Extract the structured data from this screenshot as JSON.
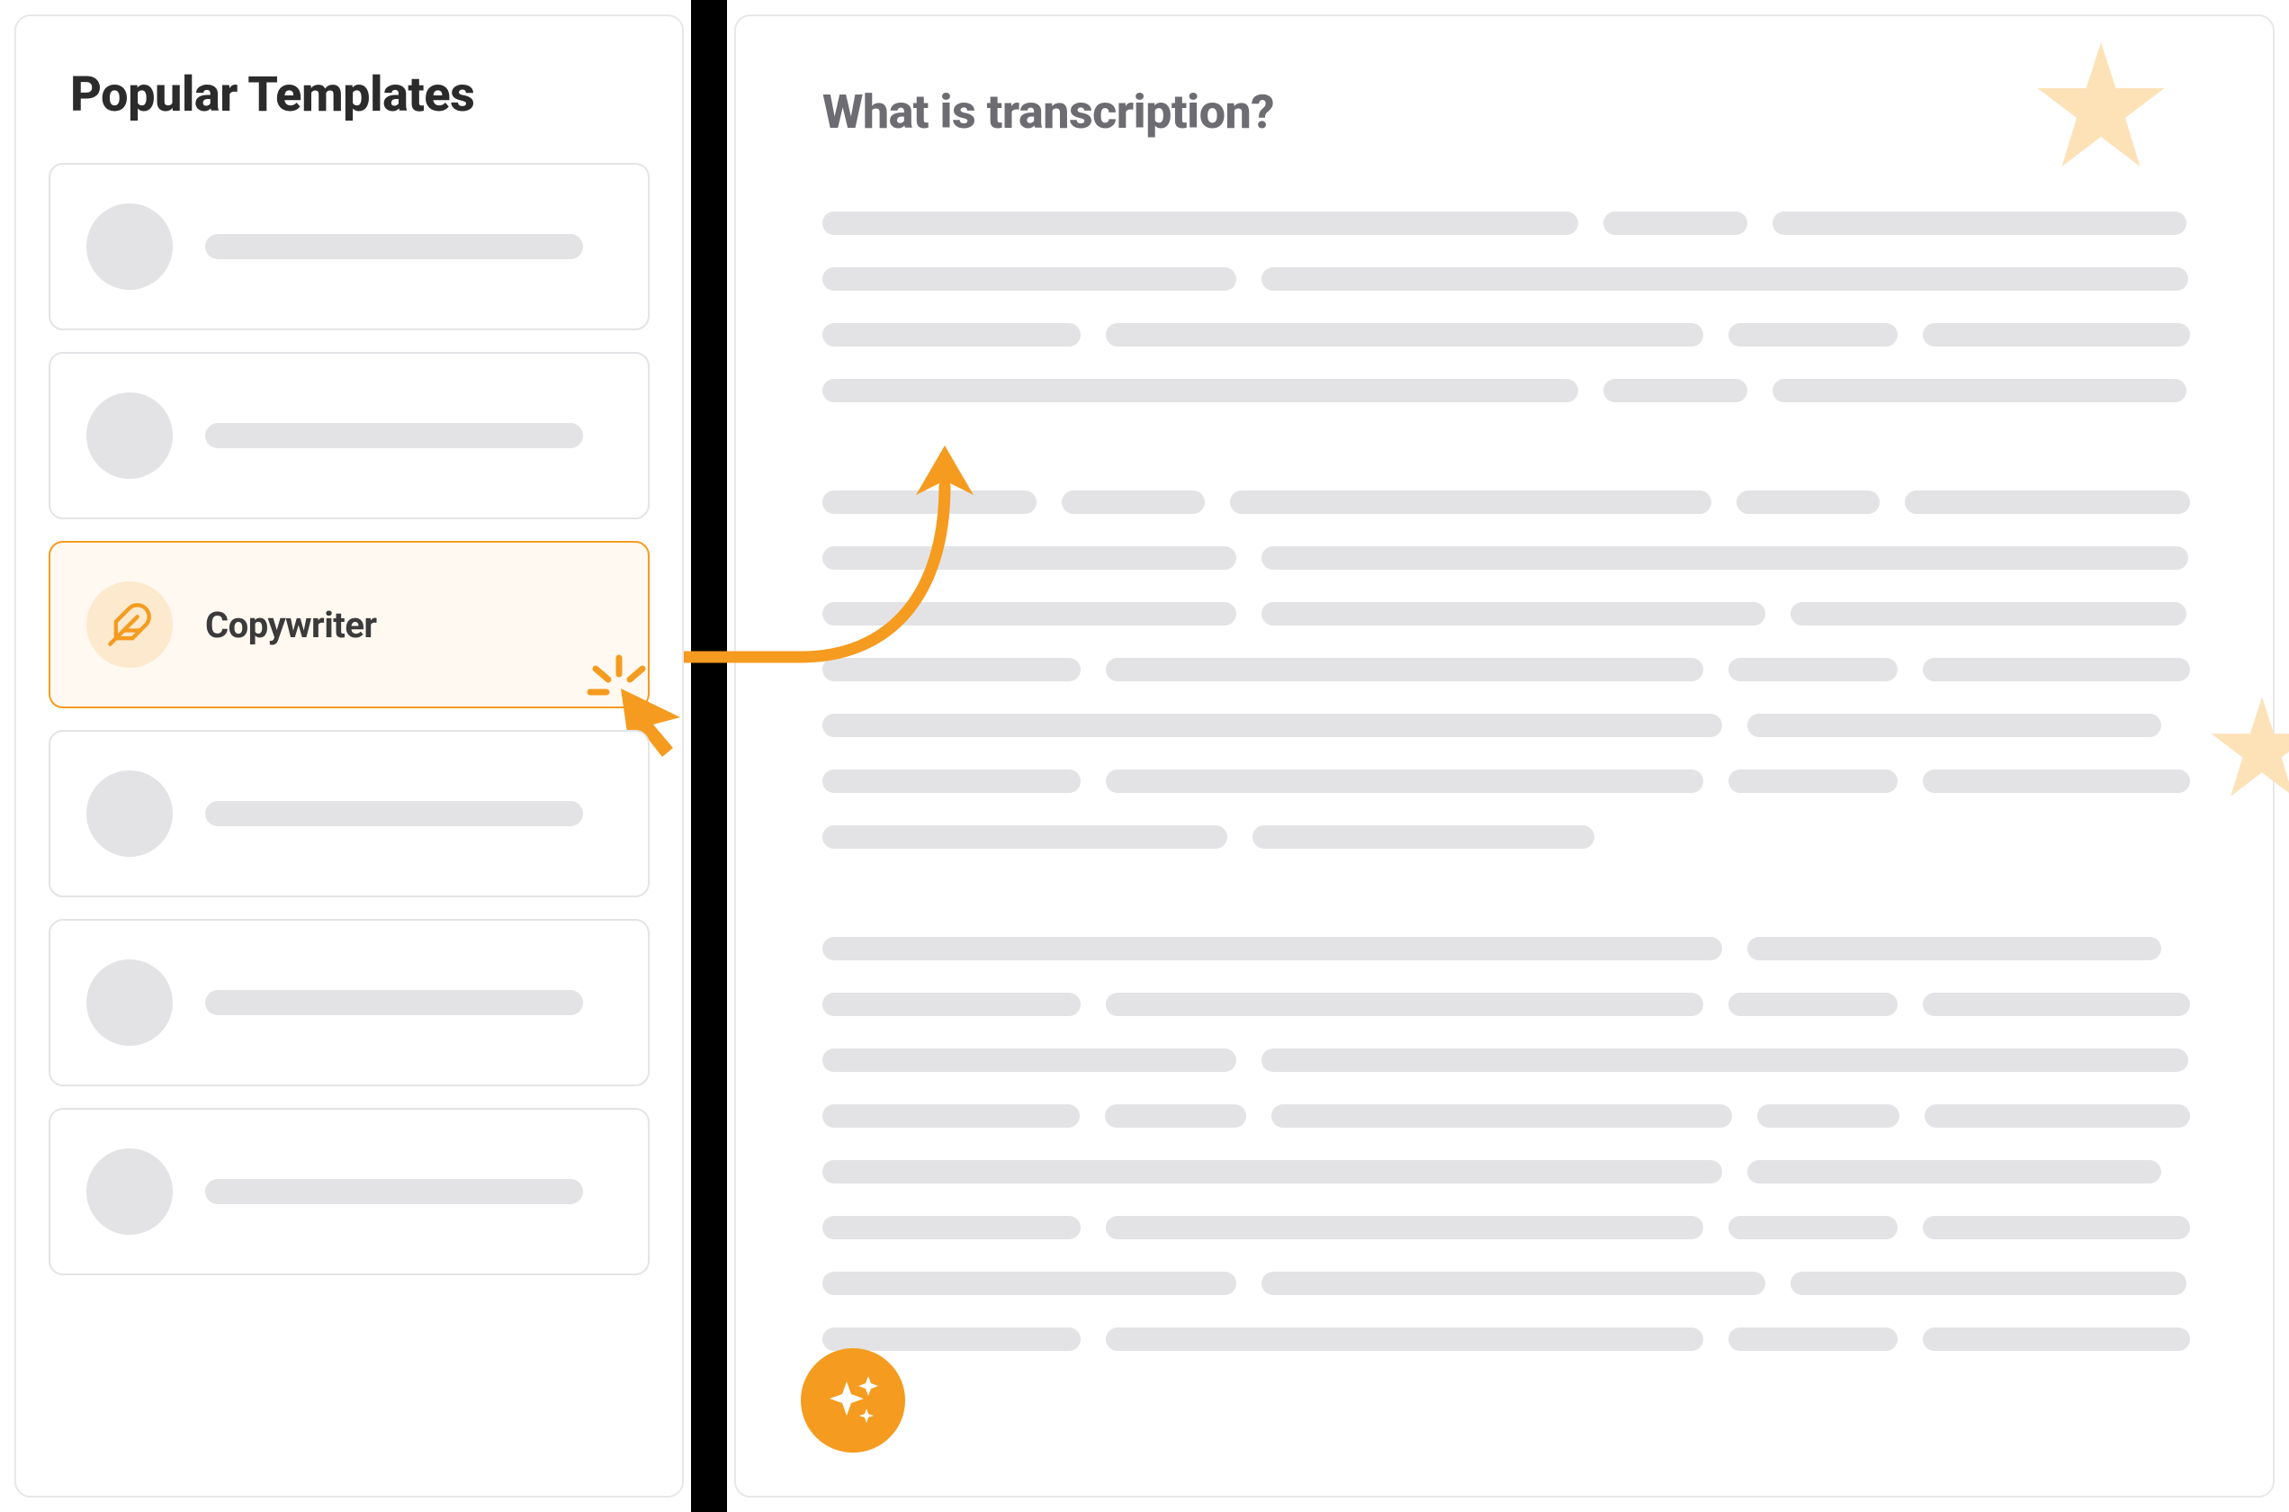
{
  "sidebar": {
    "title": "Popular Templates",
    "items": [
      {
        "label": "",
        "active": false
      },
      {
        "label": "",
        "active": false
      },
      {
        "label": "Copywriter",
        "active": true
      },
      {
        "label": "",
        "active": false
      },
      {
        "label": "",
        "active": false
      },
      {
        "label": "",
        "active": false
      }
    ]
  },
  "document": {
    "title": "What is transcription?"
  },
  "colors": {
    "accent": "#f59b1f",
    "accent_light": "#fde9cd",
    "placeholder": "#e3e3e5",
    "text_dark": "#2b2b2b",
    "text_muted": "#6c6c72"
  },
  "icons": {
    "feather": "feather-icon",
    "sparkles": "sparkles-icon",
    "star": "star-icon",
    "cursor": "cursor-click-icon",
    "arrow": "curved-arrow-icon"
  }
}
